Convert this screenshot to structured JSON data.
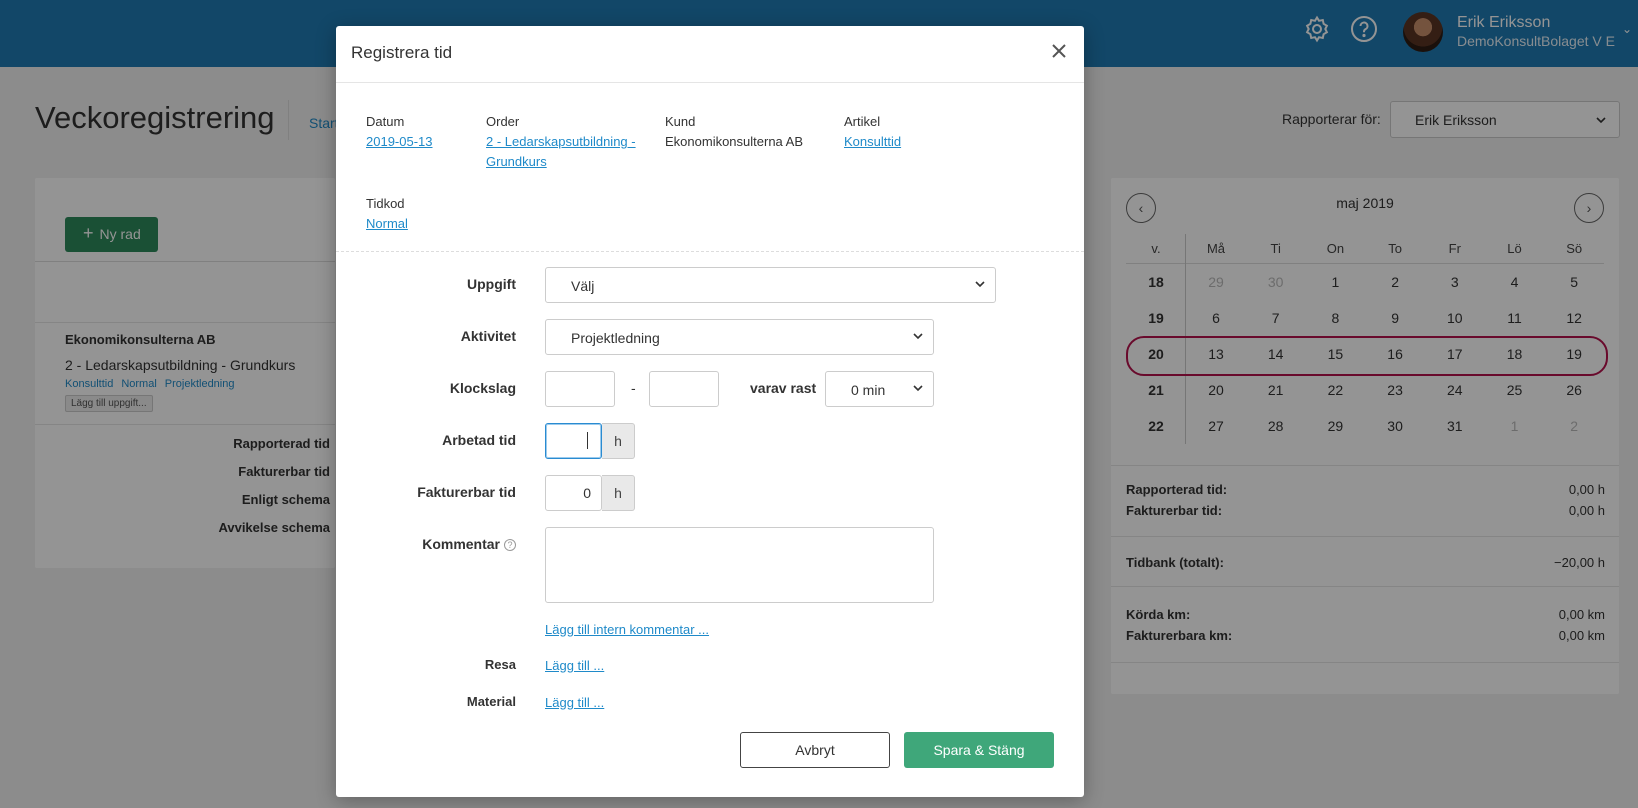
{
  "app": {
    "user_name": "Erik Eriksson",
    "user_org": "DemoKonsultBolaget V E",
    "page_title": "Veckoregistrering",
    "start_link": "Start",
    "report_for_label": "Rapporterar för:",
    "report_for_value": "Erik Eriksson",
    "new_row_button": "Ny rad",
    "row": {
      "customer": "Ekonomikonsulterna AB",
      "order": "2 - Ledarskapsutbildning - Grundkurs",
      "tags": [
        "Konsulttid",
        "Normal",
        "Projektledning"
      ],
      "add_task": "Lägg till uppgift..."
    },
    "summary_labels": [
      "Rapporterad tid",
      "Fakturerbar tid",
      "Enligt schema",
      "Avvikelse schema"
    ]
  },
  "calendar": {
    "month": "maj 2019",
    "headers": [
      "v.",
      "Må",
      "Ti",
      "On",
      "To",
      "Fr",
      "Lö",
      "Sö"
    ],
    "weeks": [
      {
        "week": "18",
        "days": [
          "29",
          "30",
          "1",
          "2",
          "3",
          "4",
          "5"
        ],
        "muted": [
          0,
          1
        ]
      },
      {
        "week": "19",
        "days": [
          "6",
          "7",
          "8",
          "9",
          "10",
          "11",
          "12"
        ],
        "muted": []
      },
      {
        "week": "20",
        "days": [
          "13",
          "14",
          "15",
          "16",
          "17",
          "18",
          "19"
        ],
        "muted": [],
        "current": true
      },
      {
        "week": "21",
        "days": [
          "20",
          "21",
          "22",
          "23",
          "24",
          "25",
          "26"
        ],
        "muted": []
      },
      {
        "week": "22",
        "days": [
          "27",
          "28",
          "29",
          "30",
          "31",
          "1",
          "2"
        ],
        "muted": [
          5,
          6
        ]
      }
    ]
  },
  "stats": {
    "reported_label": "Rapporterad tid:",
    "reported_value": "0,00 h",
    "billable_label": "Fakturerbar tid:",
    "billable_value": "0,00 h",
    "timebank_label": "Tidbank (totalt):",
    "timebank_value": "−20,00 h",
    "km_label": "Körda km:",
    "km_value": "0,00 km",
    "billable_km_label": "Fakturerbara km:",
    "billable_km_value": "0,00 km"
  },
  "modal": {
    "title": "Registrera tid",
    "info": {
      "date_label": "Datum",
      "date_value": "2019-05-13",
      "order_label": "Order",
      "order_value": "2 - Ledarskapsutbildning - Grundkurs",
      "customer_label": "Kund",
      "customer_value": "Ekonomikonsulterna AB",
      "article_label": "Artikel",
      "article_value": "Konsulttid",
      "timecode_label": "Tidkod",
      "timecode_value": "Normal"
    },
    "form": {
      "task_label": "Uppgift",
      "task_value": "Välj",
      "activity_label": "Aktivitet",
      "activity_value": "Projektledning",
      "clock_label": "Klockslag",
      "clock_from": "",
      "clock_to": "",
      "clock_sep": "-",
      "break_label": "varav rast",
      "break_value": "0 min",
      "worked_label": "Arbetad tid",
      "worked_value": "",
      "worked_unit": "h",
      "billable_label": "Fakturerbar tid",
      "billable_value": "0",
      "billable_unit": "h",
      "comment_label": "Kommentar",
      "comment_value": "",
      "internal_comment_link": "Lägg till intern kommentar ...",
      "travel_label": "Resa",
      "travel_link": "Lägg till ...",
      "material_label": "Material",
      "material_link": "Lägg till ..."
    },
    "buttons": {
      "cancel": "Avbryt",
      "save": "Spara & Stäng"
    }
  },
  "colors": {
    "topbar": "#1f7bb4",
    "primary_green": "#3fa77a",
    "link_blue": "#1f8ac9",
    "current_week_ring": "#b5124d"
  }
}
